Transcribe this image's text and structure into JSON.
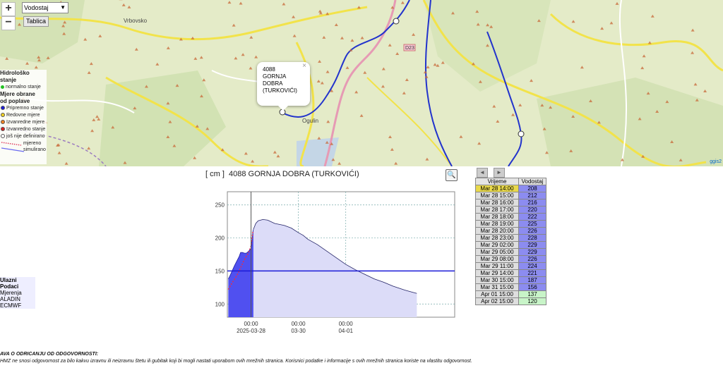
{
  "map": {
    "zoom_in": "+",
    "zoom_out": "−",
    "layer_select": "Vodostaj",
    "table_button": "Tablica",
    "town_vrbovsko": "Vrbovsko",
    "town_ogulin": "Ogulin",
    "road_label": "D23",
    "attribution": "ggis2",
    "popup": {
      "line1": "4088",
      "line2": "GORNJA",
      "line3": "DOBRA",
      "line4": "(TURKOVIĆI)",
      "close": "×"
    }
  },
  "legend": {
    "heading1a": "Hidrološko",
    "heading1b": "stanje",
    "normal": "normalno stanje",
    "heading2a": "Mjere obrane",
    "heading2b": "od poplave",
    "items": [
      {
        "label": "Pripremno stanje",
        "color": "#1a1ad8"
      },
      {
        "label": "Redovne mjere",
        "color": "#f0d020"
      },
      {
        "label": "Izvanredne mjere",
        "color": "#f08020"
      },
      {
        "label": "Izvanredno stanje",
        "color": "#d82020"
      },
      {
        "label": "još nije definirano",
        "color": "#ffffff"
      }
    ],
    "measured": "mjereno",
    "simulated": "simulirano"
  },
  "chart_header": {
    "unit": "[ cm ]",
    "station": "4088 GORNJA DOBRA (TURKOVIĆI)",
    "zoom_icon": "magnifier-icon"
  },
  "chart_data": {
    "type": "area",
    "ylim": [
      80,
      270
    ],
    "yticks": [
      100,
      150,
      200,
      250
    ],
    "xlim": [
      -0.5,
      4.3
    ],
    "xticks": [
      {
        "pos": 0,
        "time": "00:00",
        "date": "2025-03-28"
      },
      {
        "pos": 1,
        "time": "00:00",
        "date": "03-30"
      },
      {
        "pos": 2,
        "time": "00:00",
        "date": "04-01"
      }
    ],
    "threshold": 150,
    "now": 0.0,
    "measured": [
      [
        -0.48,
        138
      ],
      [
        -0.45,
        142
      ],
      [
        -0.4,
        150
      ],
      [
        -0.35,
        158
      ],
      [
        -0.3,
        165
      ],
      [
        -0.25,
        172
      ],
      [
        -0.22,
        178
      ],
      [
        -0.18,
        178
      ],
      [
        -0.14,
        177
      ],
      [
        -0.1,
        177
      ],
      [
        -0.08,
        178
      ],
      [
        -0.05,
        180
      ],
      [
        0,
        184
      ],
      [
        0.02,
        196
      ],
      [
        0.04,
        210
      ],
      [
        0.05,
        213
      ]
    ],
    "simulated": [
      [
        0.05,
        213
      ],
      [
        0.1,
        222
      ],
      [
        0.15,
        226
      ],
      [
        0.25,
        228
      ],
      [
        0.35,
        227
      ],
      [
        0.5,
        222
      ],
      [
        0.7,
        219
      ],
      [
        0.85,
        215
      ],
      [
        1,
        208
      ],
      [
        1.1,
        204
      ],
      [
        1.2,
        198
      ],
      [
        1.4,
        190
      ],
      [
        1.6,
        180
      ],
      [
        1.8,
        170
      ],
      [
        2,
        160
      ],
      [
        2.2,
        152
      ],
      [
        2.4,
        145
      ],
      [
        2.6,
        138
      ],
      [
        2.8,
        133
      ],
      [
        3,
        127
      ],
      [
        3.25,
        121
      ],
      [
        3.5,
        116
      ]
    ],
    "aladin": [
      [
        -0.48,
        122
      ],
      [
        -0.4,
        132
      ],
      [
        -0.3,
        143
      ],
      [
        -0.25,
        150
      ],
      [
        -0.2,
        158
      ],
      [
        -0.15,
        166
      ],
      [
        -0.1,
        172
      ],
      [
        -0.05,
        178
      ],
      [
        0,
        188
      ],
      [
        0.04,
        210
      ]
    ]
  },
  "inputs": {
    "heading": "Ulazni Podaci",
    "items": [
      "Mjerenja",
      "ALADIN",
      "ECMWF"
    ]
  },
  "table": {
    "nav_prev": "◄",
    "nav_next": "►",
    "col_time": "Vrijeme",
    "col_level": "Vodostaj",
    "rows": [
      {
        "t": "Mar 28 14:00",
        "v": "208"
      },
      {
        "t": "Mar 28 15:00",
        "v": "212"
      },
      {
        "t": "Mar 28 16:00",
        "v": "216"
      },
      {
        "t": "Mar 28 17:00",
        "v": "220"
      },
      {
        "t": "Mar 28 18:00",
        "v": "222"
      },
      {
        "t": "Mar 28 19:00",
        "v": "225"
      },
      {
        "t": "Mar 28 20:00",
        "v": "226"
      },
      {
        "t": "Mar 28 23:00",
        "v": "228"
      },
      {
        "t": "Mar 29 02:00",
        "v": "229"
      },
      {
        "t": "Mar 29 05:00",
        "v": "229"
      },
      {
        "t": "Mar 29 08:00",
        "v": "226"
      },
      {
        "t": "Mar 29 11:00",
        "v": "224"
      },
      {
        "t": "Mar 29 14:00",
        "v": "221"
      },
      {
        "t": "Mar 30 15:00",
        "v": "187"
      },
      {
        "t": "Mar 31 15:00",
        "v": "156"
      },
      {
        "t": "Apr 01 15:00",
        "v": "137"
      },
      {
        "t": "Apr 02 15:00",
        "v": "120"
      }
    ]
  },
  "disclaimer": {
    "heading": "AVA O ODRICANJU OD ODGOVORNOSTI:",
    "text": "HMZ ne snosi odgovornost za bilo kakvu izravnu ili neizravnu štetu ili gubitak koji bi mogli nastati uporabom ovih mrežnih stranica. Korisnici podatke i informacije s ovih mrežnih stranica koriste na vlastitu odgovornost."
  }
}
